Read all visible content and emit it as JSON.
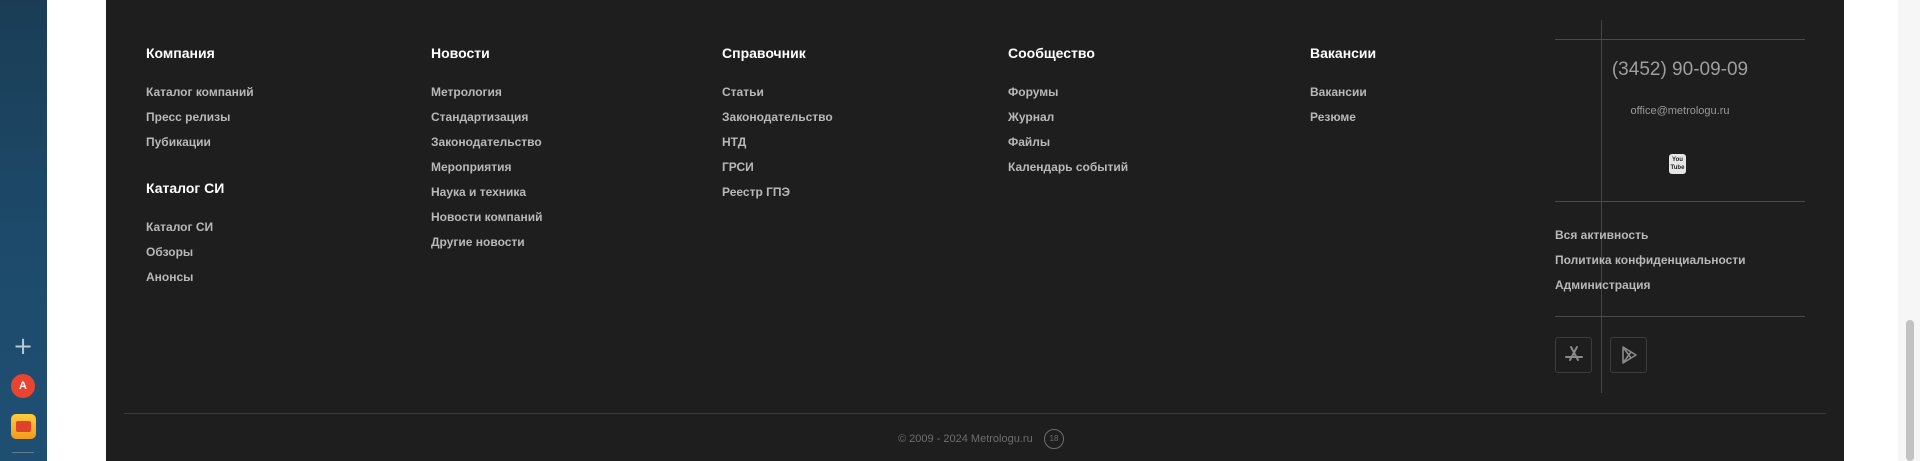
{
  "footer": {
    "columns": [
      {
        "title": "Компания",
        "links": [
          "Каталог компаний",
          "Пресс релизы",
          "Пубикации"
        ]
      },
      {
        "title": "Каталог СИ",
        "links": [
          "Каталог СИ",
          "Обзоры",
          "Анонсы"
        ]
      },
      {
        "title": "Новости",
        "links": [
          "Метрология",
          "Стандартизация",
          "Законодательство",
          "Мероприятия",
          "Наука и техника",
          "Новости компаний",
          "Другие новости"
        ]
      },
      {
        "title": "Справочник",
        "links": [
          "Статьи",
          "Законодательство",
          "НТД",
          "ГРСИ",
          "Реестр ГПЭ"
        ]
      },
      {
        "title": "Сообщество",
        "links": [
          "Форумы",
          "Журнал",
          "Файлы",
          "Календарь событий"
        ]
      },
      {
        "title": "Вакансии",
        "links": [
          "Вакансии",
          "Резюме"
        ]
      }
    ],
    "contacts": {
      "phone": "(3452) 90-09-09",
      "email": "office@metrologu.ru",
      "youtube_label_top": "You",
      "youtube_label_bottom": "Tube"
    },
    "side_links": [
      "Вся активность",
      "Политика конфиденциальности",
      "Администрация"
    ],
    "apps": [
      {
        "name": "app-store",
        "icon": "app-store-icon"
      },
      {
        "name": "google-play",
        "icon": "google-play-icon"
      }
    ],
    "copyright": "© 2009 - 2024 Metrologu.ru",
    "age_badge": "18"
  },
  "browser_sidebar": {
    "add_glyph": "+",
    "translate_glyph": "A"
  },
  "colors": {
    "footer_bg": "#1e1e1e",
    "title": "#ffffff",
    "link": "#b8b8b8",
    "muted": "#6d6d6d",
    "sidebar_bg": "#1d4a6a"
  }
}
